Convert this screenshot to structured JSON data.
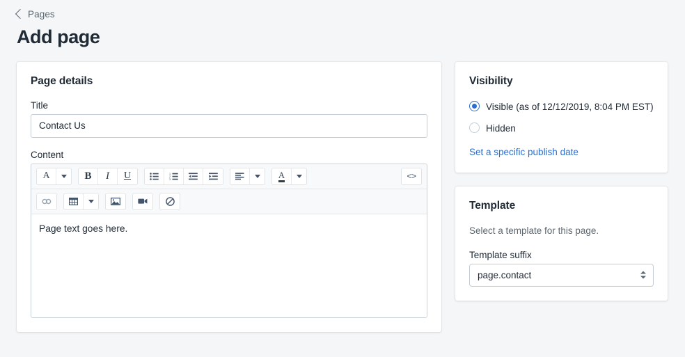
{
  "header": {
    "breadcrumb_label": "Pages",
    "breadcrumb_icon": "chevron-left-icon",
    "title": "Add page"
  },
  "page_details": {
    "card_title": "Page details",
    "title_label": "Title",
    "title_value": "Contact Us",
    "title_placeholder": "",
    "content_label": "Content",
    "content_value": "Page text goes here.",
    "toolbar": {
      "groups": [
        {
          "name": "format-group",
          "buttons": [
            {
              "name": "format-style-button",
              "icon": "letter-a-icon",
              "glyph": "A",
              "label": "Format"
            },
            {
              "name": "format-style-caret",
              "icon": "caret-down-icon",
              "glyph": "",
              "label": ""
            }
          ]
        },
        {
          "name": "inline-style-group",
          "buttons": [
            {
              "name": "bold-button",
              "icon": "bold-icon",
              "glyph": "B",
              "label": "Bold"
            },
            {
              "name": "italic-button",
              "icon": "italic-icon",
              "glyph": "I",
              "label": "Italic"
            },
            {
              "name": "underline-button",
              "icon": "underline-icon",
              "glyph": "U",
              "label": "Underline"
            }
          ]
        },
        {
          "name": "list-indent-group",
          "buttons": [
            {
              "name": "bulleted-list-button",
              "icon": "bulleted-list-icon",
              "glyph": "",
              "label": "Bulleted list"
            },
            {
              "name": "numbered-list-button",
              "icon": "numbered-list-icon",
              "glyph": "",
              "label": "Numbered list"
            },
            {
              "name": "outdent-button",
              "icon": "outdent-icon",
              "glyph": "",
              "label": "Outdent"
            },
            {
              "name": "indent-button",
              "icon": "indent-icon",
              "glyph": "",
              "label": "Indent"
            }
          ]
        },
        {
          "name": "align-group",
          "buttons": [
            {
              "name": "align-button",
              "icon": "align-left-icon",
              "glyph": "",
              "label": "Align"
            },
            {
              "name": "align-caret",
              "icon": "caret-down-icon",
              "glyph": "",
              "label": ""
            }
          ]
        },
        {
          "name": "text-color-group",
          "buttons": [
            {
              "name": "text-color-button",
              "icon": "text-color-icon",
              "glyph": "A",
              "label": "Text color"
            },
            {
              "name": "text-color-caret",
              "icon": "caret-down-icon",
              "glyph": "",
              "label": ""
            }
          ]
        }
      ],
      "code_view": {
        "name": "code-view-button",
        "icon": "code-brackets-icon",
        "glyph": "<>",
        "label": "Show HTML"
      },
      "row2": [
        {
          "name": "insert-link-button",
          "icon": "chain-link-icon",
          "glyph": "",
          "label": "Insert link",
          "disabled": true
        },
        {
          "name": "insert-table-button",
          "icon": "table-icon",
          "glyph": "",
          "label": "Insert table",
          "disabled": false
        },
        {
          "name": "table-options-caret",
          "icon": "caret-down-icon",
          "glyph": "",
          "label": "",
          "disabled": false
        },
        {
          "name": "insert-image-button",
          "icon": "image-icon",
          "glyph": "",
          "label": "Insert image",
          "disabled": false
        },
        {
          "name": "insert-video-button",
          "icon": "video-camera-icon",
          "glyph": "",
          "label": "Insert video",
          "disabled": false
        },
        {
          "name": "clear-formatting-button",
          "icon": "no-entry-icon",
          "glyph": "",
          "label": "Clear formatting",
          "disabled": false
        }
      ]
    }
  },
  "visibility": {
    "card_title": "Visibility",
    "options": [
      {
        "label": "Visible (as of 12/12/2019, 8:04 PM EST)",
        "checked": true,
        "name": "visibility-option-visible"
      },
      {
        "label": "Hidden",
        "checked": false,
        "name": "visibility-option-hidden"
      }
    ],
    "publish_date_link": "Set a specific publish date"
  },
  "template": {
    "card_title": "Template",
    "help_text": "Select a template for this page.",
    "suffix_label": "Template suffix",
    "suffix_value": "page.contact"
  },
  "colors": {
    "background": "#f4f6f8",
    "card": "#ffffff",
    "text": "#212b36",
    "subdued_text": "#5c6770",
    "link": "#2c6ecb",
    "accent": "#2c6ecb",
    "border": "#c4cdd5"
  }
}
